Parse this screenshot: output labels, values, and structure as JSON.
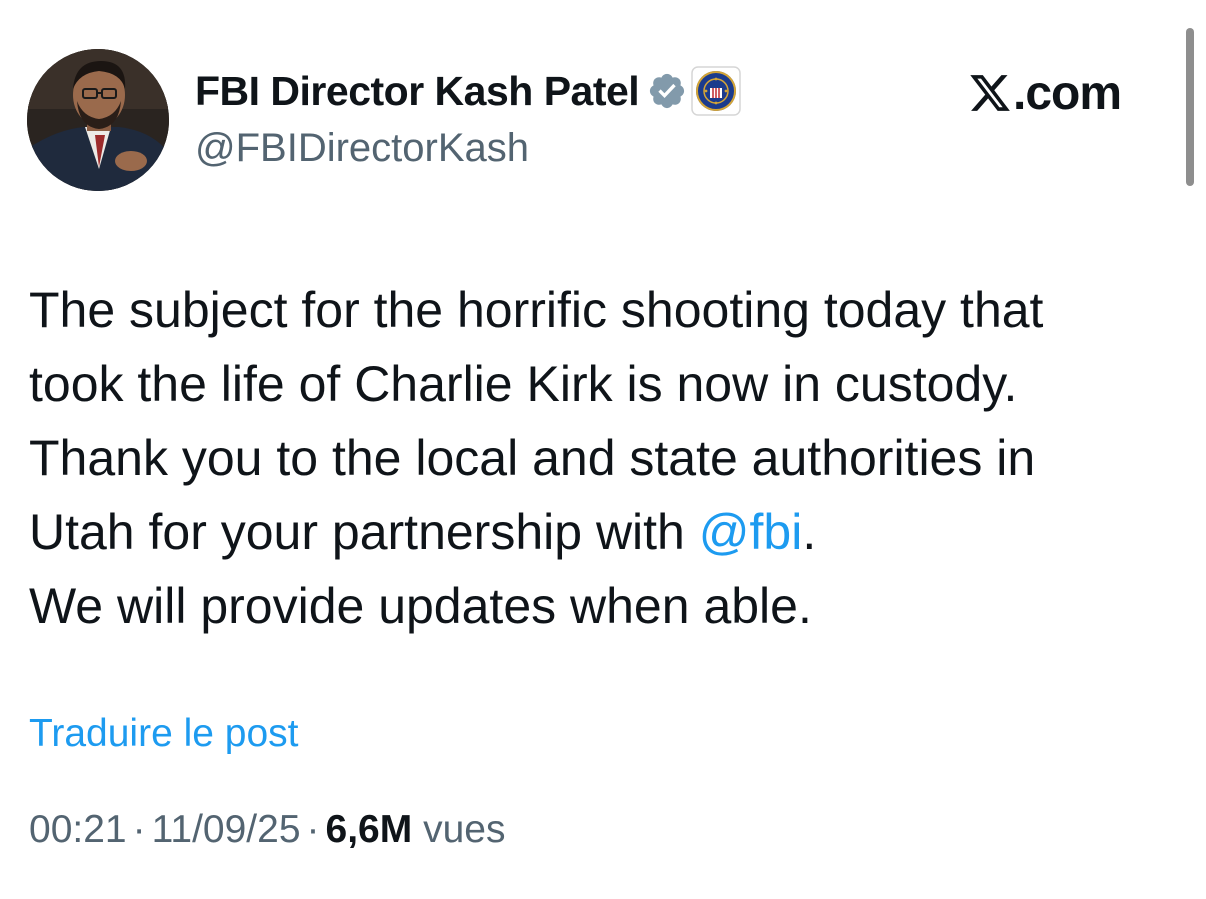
{
  "author": {
    "display_name": "FBI Director Kash Patel",
    "handle": "@FBIDirectorKash",
    "verified": true,
    "avatar_icon": "profile-photo",
    "affiliate_badge_icon": "fbi-seal-icon"
  },
  "brand": {
    "logo_icon": "x-logo-icon",
    "suffix": ".com"
  },
  "tweet": {
    "lines": [
      {
        "text": "The subject for the horrific shooting today that"
      },
      {
        "text": "took the life of Charlie Kirk is now in custody."
      },
      {
        "text": "Thank you to the local and state authorities in"
      },
      {
        "before": "Utah for your partnership with ",
        "mention": "@fbi",
        "after": "."
      },
      {
        "text": "We will provide updates when able."
      }
    ]
  },
  "translate_label": "Traduire le post",
  "meta": {
    "time": "00:21",
    "separator": "·",
    "date": "11/09/25",
    "views_count": "6,6M",
    "views_label": "vues"
  },
  "colors": {
    "text": "#0f1419",
    "secondary": "#536471",
    "link": "#1d9bf0",
    "verified_badge": "#829aab"
  }
}
